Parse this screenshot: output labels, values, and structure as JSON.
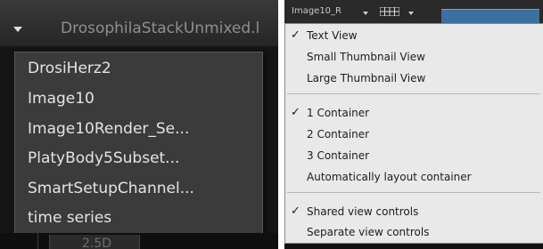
{
  "left": {
    "tab_title": "DrosophilaStackUnmixed.l",
    "menu_items": [
      "DrosiHerz2",
      "Image10",
      "Image10Render_Se...",
      "PlatyBody5Subset...",
      "SmartSetupChannel...",
      "time series"
    ],
    "bottom_tab_label": "2.5D"
  },
  "right": {
    "image_label": "Image10_R",
    "menu_sections": [
      {
        "items": [
          {
            "label": "Text View",
            "checked": true
          },
          {
            "label": "Small Thumbnail View",
            "checked": false
          },
          {
            "label": "Large Thumbnail View",
            "checked": false
          }
        ]
      },
      {
        "items": [
          {
            "label": "1 Container",
            "checked": true
          },
          {
            "label": "2 Container",
            "checked": false
          },
          {
            "label": "3 Container",
            "checked": false
          },
          {
            "label": "Automatically layout container",
            "checked": false
          }
        ]
      },
      {
        "items": [
          {
            "label": "Shared view controls",
            "checked": true
          },
          {
            "label": "Separate view controls",
            "checked": false
          }
        ]
      }
    ],
    "check_glyph": "✓"
  },
  "icons": {
    "dropdown": "chevron-down-icon",
    "grid": "grid-view-icon",
    "check": "check-icon"
  },
  "colors": {
    "dark_bg": "#151515",
    "menu_dark": "#3b3b3b",
    "menu_light": "#e9e9e9",
    "accent_blue": "#3d6f9f"
  }
}
